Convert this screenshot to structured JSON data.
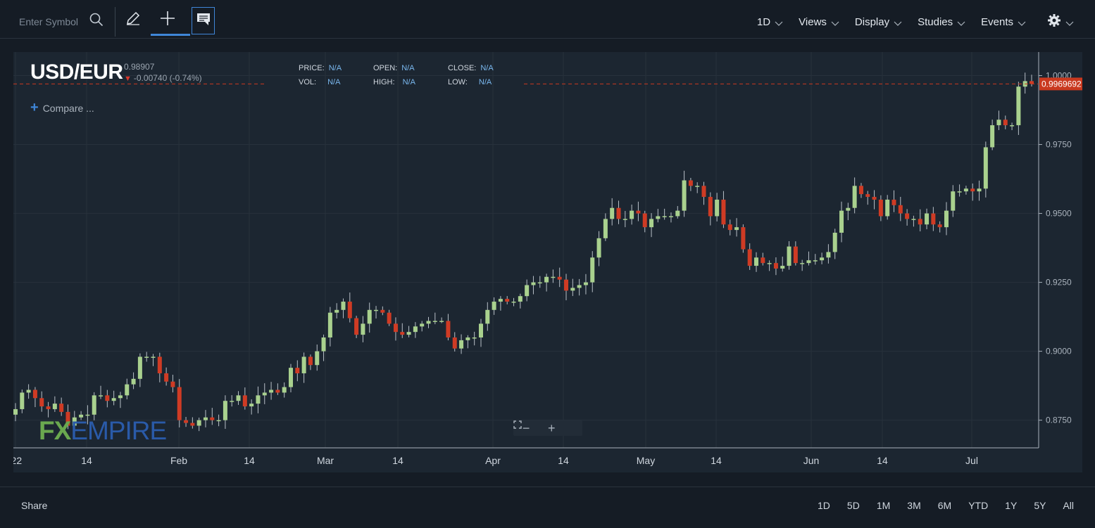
{
  "toolbar": {
    "search_placeholder": "Enter Symbol",
    "menus": [
      "1D",
      "Views",
      "Display",
      "Studies",
      "Events"
    ],
    "icons": [
      "search-icon",
      "pencil-icon",
      "crosshair-icon",
      "chat-icon",
      "gear-icon"
    ]
  },
  "legend": {
    "symbol": "USD/EUR",
    "last_price": "0.98907",
    "change": "-0.00740 (-0.74%)",
    "compare_label": "Compare ...",
    "ohlc": {
      "price_label": "PRICE:",
      "price_value": "N/A",
      "vol_label": "VOL:",
      "vol_value": "N/A",
      "open_label": "OPEN:",
      "open_value": "N/A",
      "high_label": "HIGH:",
      "high_value": "N/A",
      "close_label": "CLOSE:",
      "close_value": "N/A",
      "low_label": "LOW:",
      "low_value": "N/A"
    }
  },
  "current_price_tag": "0.9969692",
  "watermark": {
    "part1": "FX",
    "part2": "EMPIRE"
  },
  "zoom_controls": {
    "minus": "−",
    "plus": "+"
  },
  "bottom": {
    "share_label": "Share",
    "ranges": [
      "1D",
      "5D",
      "1M",
      "3M",
      "6M",
      "YTD",
      "1Y",
      "5Y",
      "All"
    ]
  },
  "colors": {
    "up": "#a9d18e",
    "down": "#cf3b24",
    "accent": "#3f86d8",
    "price_tag": "#c9391f"
  },
  "chart_data": {
    "type": "candlestick",
    "title": "USD/EUR",
    "y_ticks": [
      "1.0000",
      "0.9750",
      "0.9500",
      "0.9250",
      "0.9000",
      "0.8750"
    ],
    "x_ticks": [
      "'22",
      "14",
      "Feb",
      "14",
      "Mar",
      "14",
      "Apr",
      "14",
      "May",
      "14",
      "Jun",
      "14",
      "Jul"
    ],
    "ylim": [
      0.867,
      1.006
    ],
    "last_value": 0.9969692,
    "closes": [
      0.879,
      0.885,
      0.886,
      0.883,
      0.88,
      0.879,
      0.881,
      0.878,
      0.873,
      0.876,
      0.877,
      0.877,
      0.884,
      0.884,
      0.882,
      0.883,
      0.884,
      0.888,
      0.89,
      0.898,
      0.898,
      0.898,
      0.892,
      0.889,
      0.887,
      0.875,
      0.874,
      0.873,
      0.875,
      0.876,
      0.875,
      0.875,
      0.882,
      0.882,
      0.884,
      0.88,
      0.881,
      0.884,
      0.885,
      0.886,
      0.885,
      0.887,
      0.894,
      0.892,
      0.898,
      0.895,
      0.9,
      0.905,
      0.914,
      0.915,
      0.918,
      0.912,
      0.906,
      0.91,
      0.915,
      0.915,
      0.914,
      0.91,
      0.907,
      0.906,
      0.907,
      0.909,
      0.91,
      0.911,
      0.911,
      0.911,
      0.905,
      0.901,
      0.904,
      0.905,
      0.905,
      0.91,
      0.915,
      0.918,
      0.919,
      0.918,
      0.918,
      0.92,
      0.924,
      0.925,
      0.925,
      0.927,
      0.927,
      0.926,
      0.922,
      0.923,
      0.924,
      0.925,
      0.934,
      0.941,
      0.948,
      0.952,
      0.948,
      0.948,
      0.951,
      0.95,
      0.945,
      0.948,
      0.949,
      0.949,
      0.949,
      0.951,
      0.962,
      0.96,
      0.96,
      0.956,
      0.949,
      0.955,
      0.946,
      0.944,
      0.945,
      0.937,
      0.931,
      0.934,
      0.932,
      0.932,
      0.93,
      0.931,
      0.938,
      0.932,
      0.932,
      0.933,
      0.933,
      0.934,
      0.936,
      0.943,
      0.951,
      0.952,
      0.96,
      0.957,
      0.956,
      0.955,
      0.949,
      0.955,
      0.953,
      0.95,
      0.948,
      0.948,
      0.946,
      0.95,
      0.946,
      0.945,
      0.951,
      0.958,
      0.958,
      0.959,
      0.958,
      0.959,
      0.974,
      0.982,
      0.984,
      0.982,
      0.982,
      0.996,
      0.998,
      0.997
    ]
  }
}
